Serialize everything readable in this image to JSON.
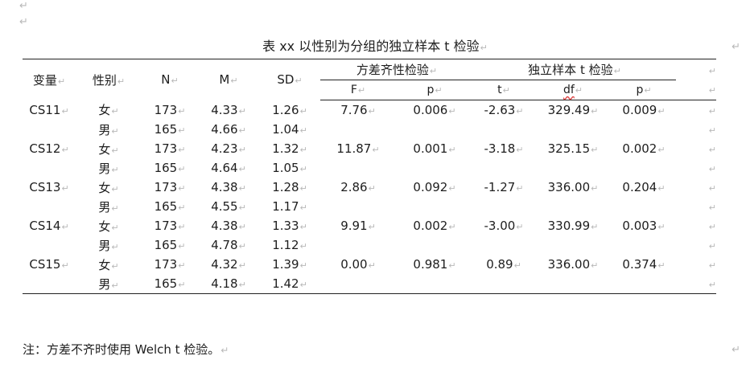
{
  "para_mark": "↵",
  "title": "表 xx  以性别为分组的独立样本 t 检验",
  "headers": {
    "var": "变量",
    "gender": "性别",
    "n": "N",
    "m": "M",
    "sd": "SD",
    "levene_group": "方差齐性检验",
    "ttest_group": "独立样本 t 检验",
    "f": "F",
    "p1": "p",
    "t": "t",
    "df": "df",
    "p2": "p"
  },
  "rows": [
    {
      "var": "CS11",
      "female": {
        "g": "女",
        "n": "173",
        "m": "4.33",
        "sd": "1.26"
      },
      "male": {
        "g": "男",
        "n": "165",
        "m": "4.66",
        "sd": "1.04"
      },
      "f": "7.76",
      "p1": "0.006",
      "t": "-2.63",
      "df": "329.49",
      "p2": "0.009"
    },
    {
      "var": "CS12",
      "female": {
        "g": "女",
        "n": "173",
        "m": "4.23",
        "sd": "1.32"
      },
      "male": {
        "g": "男",
        "n": "165",
        "m": "4.64",
        "sd": "1.05"
      },
      "f": "11.87",
      "p1": "0.001",
      "t": "-3.18",
      "df": "325.15",
      "p2": "0.002"
    },
    {
      "var": "CS13",
      "female": {
        "g": "女",
        "n": "173",
        "m": "4.38",
        "sd": "1.28"
      },
      "male": {
        "g": "男",
        "n": "165",
        "m": "4.55",
        "sd": "1.17"
      },
      "f": "2.86",
      "p1": "0.092",
      "t": "-1.27",
      "df": "336.00",
      "p2": "0.204"
    },
    {
      "var": "CS14",
      "female": {
        "g": "女",
        "n": "173",
        "m": "4.38",
        "sd": "1.33"
      },
      "male": {
        "g": "男",
        "n": "165",
        "m": "4.78",
        "sd": "1.12"
      },
      "f": "9.91",
      "p1": "0.002",
      "t": "-3.00",
      "df": "330.99",
      "p2": "0.003"
    },
    {
      "var": "CS15",
      "female": {
        "g": "女",
        "n": "173",
        "m": "4.32",
        "sd": "1.39"
      },
      "male": {
        "g": "男",
        "n": "165",
        "m": "4.18",
        "sd": "1.42"
      },
      "f": "0.00",
      "p1": "0.981",
      "t": "0.89",
      "df": "336.00",
      "p2": "0.374"
    }
  ],
  "note": "注：方差不齐时使用 Welch t 检验。"
}
